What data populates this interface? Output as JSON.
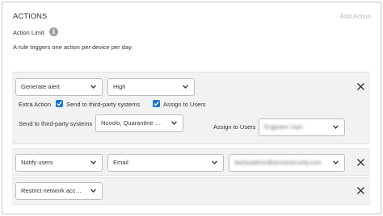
{
  "header": {
    "title": "ACTIONS",
    "add_action_label": "Add Action"
  },
  "action_limit": {
    "label": "Action Limit",
    "description": "A rule triggers one action per device per day."
  },
  "actions": [
    {
      "type": "Generate alert",
      "severity": "High",
      "extra_action_label": "Extra Action",
      "send_third_party_label": "Send to third-party systems",
      "send_third_party_checked": true,
      "assign_users_label": "Assign to Users",
      "assign_users_checked": true,
      "third_party_field_label": "Send to third-party systems",
      "third_party_value": "Nuvolo, Quarantine via ...",
      "assign_field_label": "Assign to Users",
      "assign_value": "Engineer User"
    },
    {
      "type": "Notify users",
      "channel": "Email",
      "recipient": "dashyadmin@armissecurity.com"
    },
    {
      "type": "Restrict network access"
    }
  ],
  "colors": {
    "checkbox": "#1a73c9",
    "border": "#bdbdbd",
    "block_bg": "#f2f2f2",
    "muted_link": "#b8b8b8"
  },
  "icons": [
    "info-icon",
    "chevron-down-icon",
    "close-icon",
    "checkmark-icon"
  ]
}
